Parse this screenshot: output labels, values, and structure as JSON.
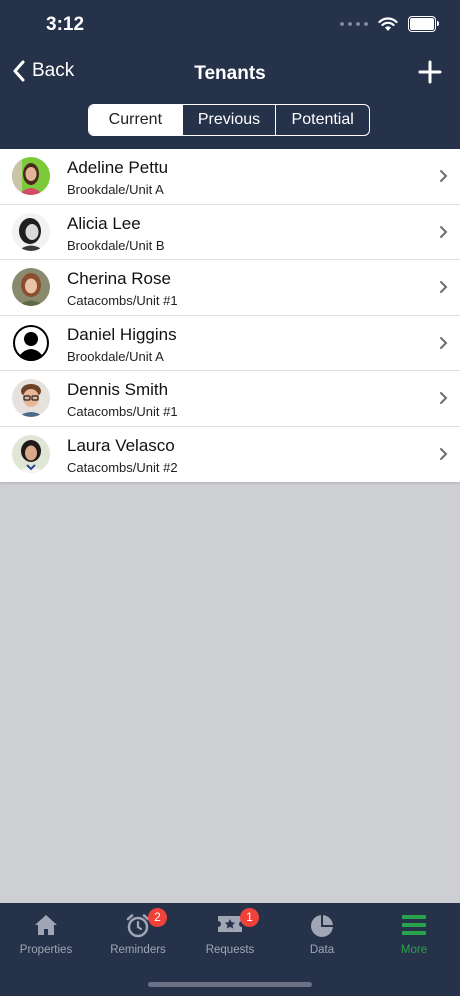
{
  "status_bar": {
    "time": "3:12"
  },
  "nav": {
    "back_label": "Back",
    "title": "Tenants"
  },
  "segments": [
    "Current",
    "Previous",
    "Potential"
  ],
  "tenants": [
    {
      "name": "Adeline Pettu",
      "address": "Brookdale/Unit A"
    },
    {
      "name": "Alicia Lee",
      "address": "Brookdale/Unit B"
    },
    {
      "name": "Cherina Rose",
      "address": "Catacombs/Unit #1"
    },
    {
      "name": "Daniel Higgins",
      "address": "Brookdale/Unit A"
    },
    {
      "name": "Dennis Smith",
      "address": "Catacombs/Unit #1"
    },
    {
      "name": "Laura Velasco",
      "address": "Catacombs/Unit #2"
    }
  ],
  "tabs": [
    {
      "label": "Properties",
      "icon": "home-icon"
    },
    {
      "label": "Reminders",
      "icon": "alarm-clock-icon",
      "badge": "2"
    },
    {
      "label": "Requests",
      "icon": "ticket-icon",
      "badge": "1"
    },
    {
      "label": "Data",
      "icon": "pie-chart-icon"
    },
    {
      "label": "More",
      "icon": "menu-icon",
      "active": true
    }
  ],
  "colors": {
    "header": "#26324a",
    "accent": "#2aa44b",
    "badge": "#f0413a",
    "background": "#cdcfd3"
  }
}
